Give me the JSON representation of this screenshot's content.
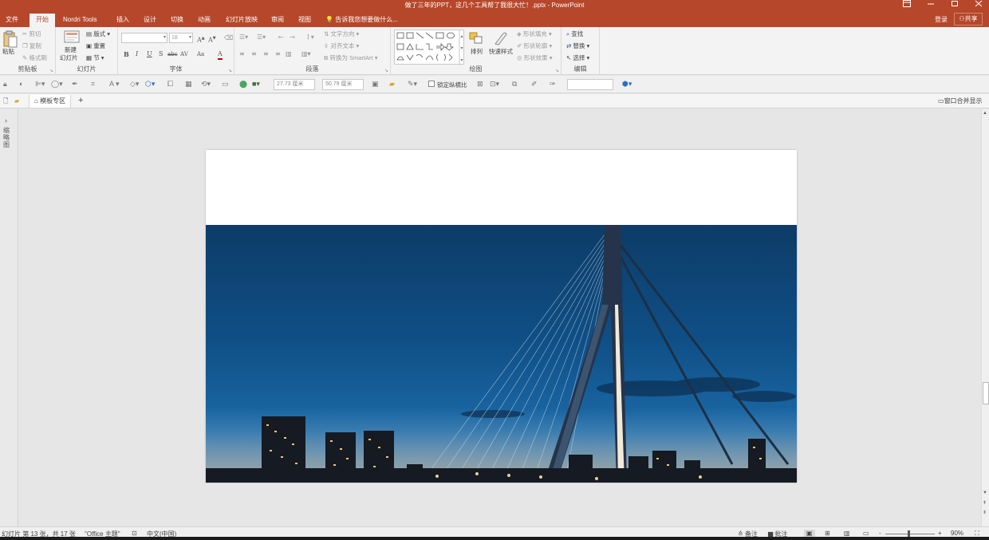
{
  "window": {
    "title": "做了三年的PPT，这几个工具帮了我很大忙！.pptx - PowerPoint",
    "layout_icon": "ribbon-display-icon",
    "controls": [
      "minimize-icon",
      "restore-icon",
      "close-icon"
    ]
  },
  "tabs": {
    "items": [
      "文件",
      "开始",
      "Nordri Tools",
      "插入",
      "设计",
      "切换",
      "动画",
      "幻灯片放映",
      "审阅",
      "视图"
    ],
    "active": "开始",
    "tell_me": "告诉我您想要做什么...",
    "login": "登录",
    "share": "共享"
  },
  "ribbon": {
    "clipboard": {
      "paste": "粘贴",
      "cut": "剪切",
      "copy": "复制",
      "format_painter": "格式刷",
      "label": "剪贴板"
    },
    "slides": {
      "new_slide_line1": "新建",
      "new_slide_line2": "幻灯片",
      "layout": "版式",
      "reset": "重置",
      "section": "节",
      "label": "幻灯片"
    },
    "font": {
      "font_name": "",
      "font_size": "18",
      "label": "字体",
      "format_buttons": [
        "B",
        "I",
        "U",
        "S",
        "abc",
        "AV",
        "Aa",
        "A"
      ]
    },
    "paragraph": {
      "text_direction": "文字方向",
      "align_text": "对齐文本",
      "convert_smartart": "转换为 SmartArt",
      "label": "段落"
    },
    "drawing": {
      "arrange": "排列",
      "quick_styles": "快速样式",
      "shape_fill": "形状填充",
      "shape_outline": "形状轮廓",
      "shape_effects": "形状效果",
      "label": "绘图"
    },
    "editing": {
      "find": "查找",
      "replace": "替换",
      "select": "选择",
      "label": "编辑"
    }
  },
  "toolbar2": {
    "width": "27.73 厘米",
    "height": "50.79 厘米",
    "lock_ratio": "锁定纵横比"
  },
  "docbar": {
    "template_tab": "模板专区",
    "add_tab": "+",
    "merge_window": "窗口合并显示"
  },
  "left_pane": {
    "label": "缩略图"
  },
  "statusbar": {
    "slide_info": "幻灯片 第 13 张，共 17 张",
    "theme": "\"Office 主题\"",
    "language": "中文(中国)",
    "notes": "备注",
    "comments": "批注",
    "zoom_minus": "-",
    "zoom_plus": "+",
    "zoom": "90%"
  },
  "colors": {
    "accent": "#b7472a",
    "ribbon_bg": "#f3f3f3",
    "canvas_bg": "#e6e6e6"
  }
}
